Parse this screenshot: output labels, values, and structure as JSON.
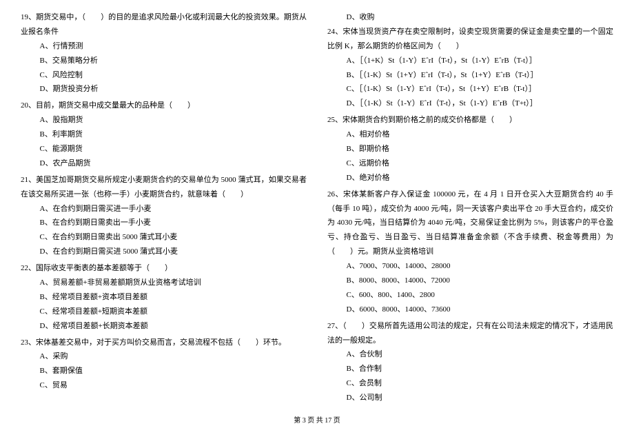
{
  "left": {
    "q19": {
      "text": "19、期货交易中，（　　）的目的是追求风险最小化或利润最大化的投资效果。期货从业报名条件",
      "opts": [
        "A、行情预测",
        "B、交易策略分析",
        "C、风险控制",
        "D、期货投资分析"
      ]
    },
    "q20": {
      "text": "20、目前，期货交易中成交量最大的品种是（　　）",
      "opts": [
        "A、股指期货",
        "B、利率期货",
        "C、能源期货",
        "D、农产品期货"
      ]
    },
    "q21": {
      "text": "21、美国芝加哥期货交易所规定小麦期货合约的交易单位为 5000 蒲式耳，如果交易者在该交易所买进一张（也称一手）小麦期货合约，就意味着（　　）",
      "opts": [
        "A、在合约到期日需买进一手小麦",
        "B、在合约到期日需卖出一手小麦",
        "C、在合约到期日需卖出 5000 蒲式耳小麦",
        "D、在合约到期日需买进 5000 蒲式耳小麦"
      ]
    },
    "q22": {
      "text": "22、国际收支平衡表的基本差额等于（　　）",
      "opts": [
        "A、贸易差额+非贸易差额期货从业资格考试培训",
        "B、经常项目差额+资本项目差额",
        "C、经常项目差额+短期资本差额",
        "D、经常项目差额+长期资本差额"
      ]
    },
    "q23": {
      "text": "23、宋体基差交易中，对于买方叫价交易而言，交易流程不包括（　　）环节。",
      "opts": [
        "A、采购",
        "B、套期保值",
        "C、贸易"
      ]
    }
  },
  "right": {
    "q23d": "D、收购",
    "q24": {
      "text": "24、宋体当现货资产存在卖空限制时，设卖空现货需要的保证金是卖空量的一个固定比例 K，那么期货的价格区间为（　　）",
      "opts": [
        "A、［（1+K）St（1-Y）EˆrI（T-t），St（1-Y）EˆrB（T-t）］",
        "B、［（1-K）St（1+Y）EˆrI（T-t），St（1+Y）EˆrB（T-t）］",
        "C、［（1-K）St（1-Y）EˆrI（T-t），St（1+Y）EˆrB（T-t）］",
        "D、［（1-K）St（1-Y）EˆrI（T-t），St（1-Y）EˆrB（T+t）］"
      ]
    },
    "q25": {
      "text": "25、宋体期货合约到期价格之前的成交价格都是（　　）",
      "opts": [
        "A、相对价格",
        "B、即期价格",
        "C、远期价格",
        "D、绝对价格"
      ]
    },
    "q26": {
      "text": "26、宋体某新客户存入保证金 100000 元，在 4 月 1 日开仓买入大豆期货合约 40 手（每手 10 吨），成交价为 4000 元/吨，同一天该客户卖出平仓 20 手大豆合约，成交价为 4030 元/吨，当日结算价为 4040 元/吨，交易保证金比例为 5%，则该客户的平仓盈亏、持仓盈亏、当日盈亏、当日结算准备金余额（不含手续费、税金等费用）为（　　）元。期货从业资格培训",
      "opts": [
        "A、7000、7000、14000、28000",
        "B、8000、8000、14000、72000",
        "C、600、800、1400、2800",
        "D、6000、8000、14000、73600"
      ]
    },
    "q27": {
      "text": "27、（　　）交易所首先适用公司法的规定，只有在公司法未规定的情况下，才适用民法的一般规定。",
      "opts": [
        "A、合伙制",
        "B、合作制",
        "C、会员制",
        "D、公司制"
      ]
    }
  },
  "footer": "第 3 页 共 17 页"
}
